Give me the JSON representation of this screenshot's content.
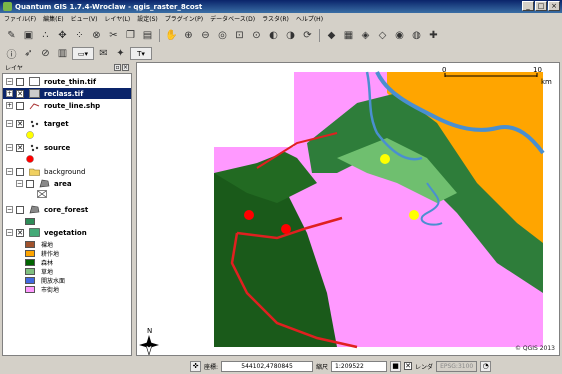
{
  "window": {
    "title": "Quantum GIS 1.7.4-Wroclaw - qgis_raster_8cost"
  },
  "menu": [
    "ファイル(F)",
    "編集(E)",
    "ビュー(V)",
    "レイヤ(L)",
    "設定(S)",
    "プラグイン(P)",
    "データベース(D)",
    "ラスタ(R)",
    "ヘルプ(H)"
  ],
  "layers_panel": {
    "title": "レイヤ",
    "layers": [
      {
        "name": "route_thin.tif",
        "checked": false,
        "selected": false
      },
      {
        "name": "reclass.tif",
        "checked": true,
        "selected": true
      },
      {
        "name": "route_line.shp",
        "checked": false,
        "selected": false
      },
      {
        "name": "target",
        "checked": true,
        "selected": false
      },
      {
        "name": "source",
        "checked": true,
        "selected": false
      },
      {
        "name": "background",
        "checked": false,
        "selected": false,
        "group": true
      },
      {
        "name": "area",
        "checked": false,
        "selected": false
      },
      {
        "name": "core_forest",
        "checked": false,
        "selected": false
      },
      {
        "name": "vegetation",
        "checked": true,
        "selected": false
      }
    ],
    "vegetation_legend": [
      {
        "label": "裸地",
        "color": "#a0522d"
      },
      {
        "label": "耕作地",
        "color": "#ffa500"
      },
      {
        "label": "森林",
        "color": "#006400"
      },
      {
        "label": "草地",
        "color": "#7fbf7f"
      },
      {
        "label": "開放水面",
        "color": "#4169e1"
      },
      {
        "label": "市街地",
        "color": "#ff99ff"
      }
    ],
    "symbol_colors": {
      "target": "#ffff00",
      "source": "#ff0000",
      "core_forest": "#2e8b57"
    }
  },
  "map": {
    "scale_bar": {
      "start": "0",
      "end": "10",
      "unit": "km"
    },
    "copyright": "© QGIS 2013"
  },
  "status": {
    "coord_label": "座標:",
    "coord_value": "544102,4780845",
    "scale_label": "縮尺",
    "scale_value": "1:209522",
    "render_label": "レンダ",
    "epsg": "EPSG:3100"
  }
}
